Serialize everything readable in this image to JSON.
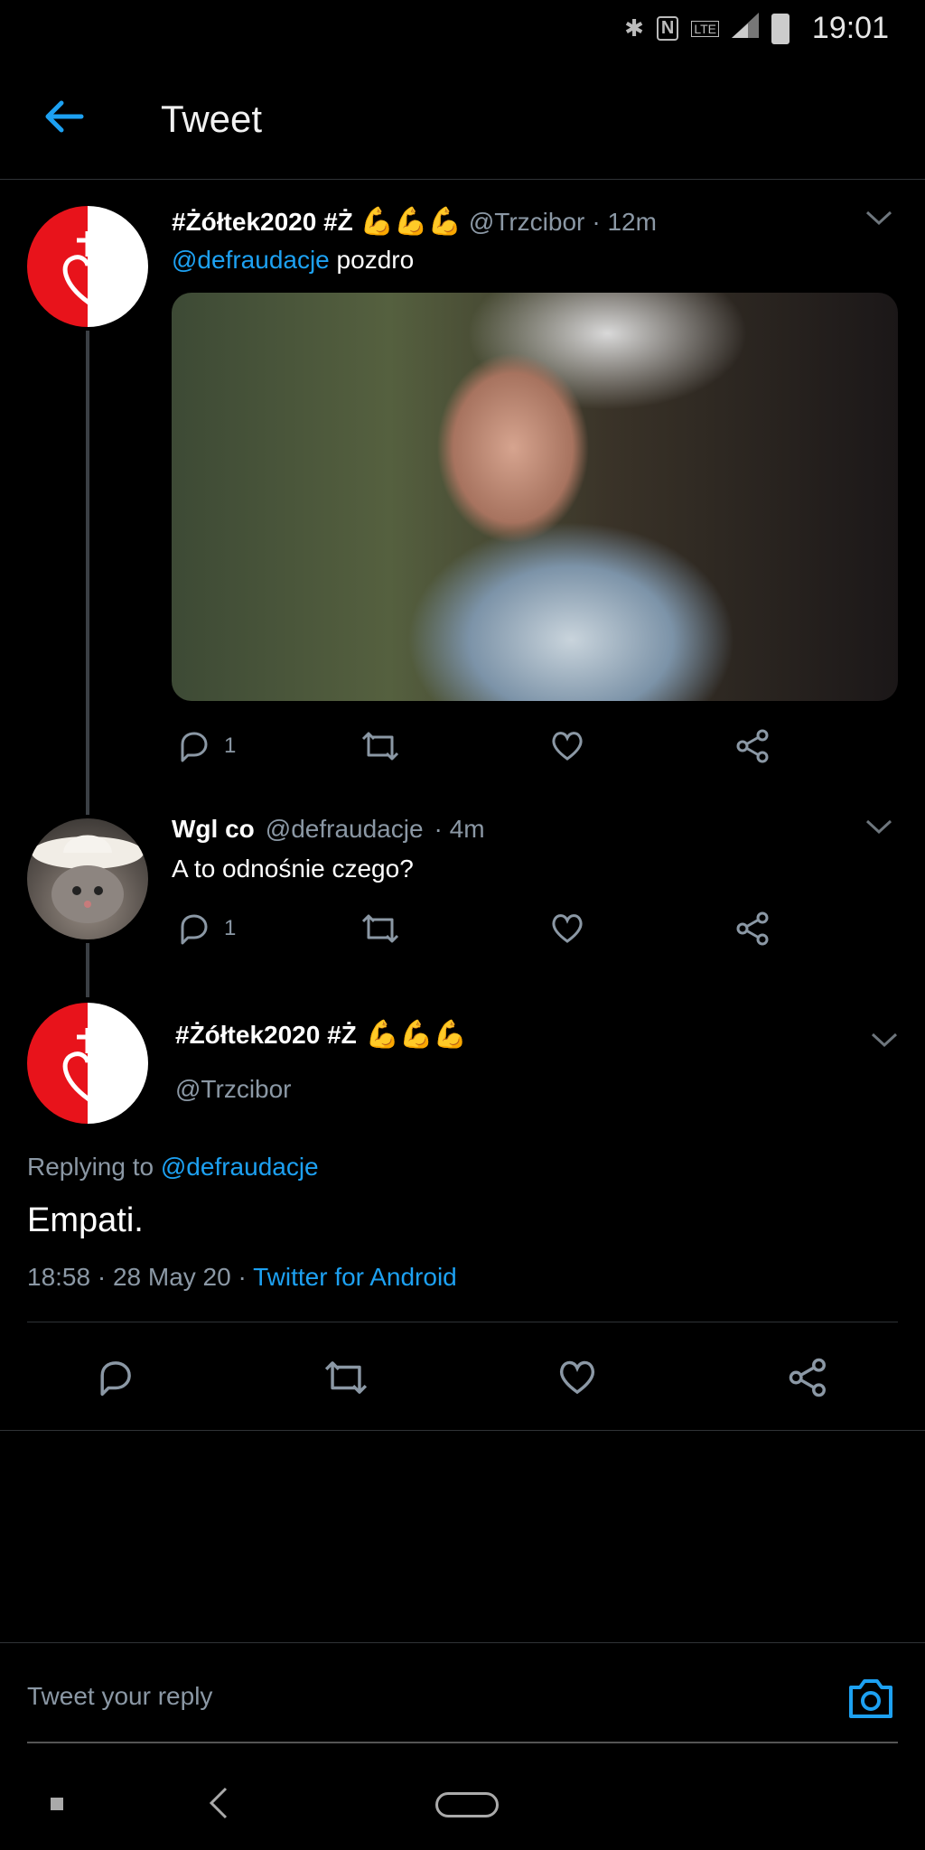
{
  "status_bar": {
    "time": "19:01",
    "icons": [
      "bluetooth-icon",
      "nfc-icon",
      "lte-icon",
      "signal-icon",
      "battery-icon"
    ],
    "lte_label": "LTE"
  },
  "header": {
    "title": "Tweet"
  },
  "tweet1": {
    "name": "#Żółtek2020 #Ż",
    "emoji": "💪💪💪",
    "handle": "@Trzcibor",
    "time": "· 12m",
    "mention": "@defraudacje",
    "text": " pozdro",
    "reply_count": "1"
  },
  "tweet2": {
    "name": "Wgl co",
    "handle": "@defraudacje",
    "time": "· 4m",
    "text": "A to odnośnie czego?",
    "reply_count": "1"
  },
  "main_tweet": {
    "name": "#Żółtek2020 #Ż",
    "emoji": "💪💪💪",
    "handle": "@Trzcibor",
    "replying_prefix": "Replying to ",
    "replying_handle": "@defraudacje",
    "text": "Empati.",
    "meta": "18:58 · 28 May 20 · ",
    "source": "Twitter for Android"
  },
  "reply_input": {
    "placeholder": "Tweet your reply"
  },
  "colors": {
    "accent": "#1da1f2",
    "background": "#000000",
    "muted": "#8b98a5",
    "avatar_red": "#e8131b"
  }
}
